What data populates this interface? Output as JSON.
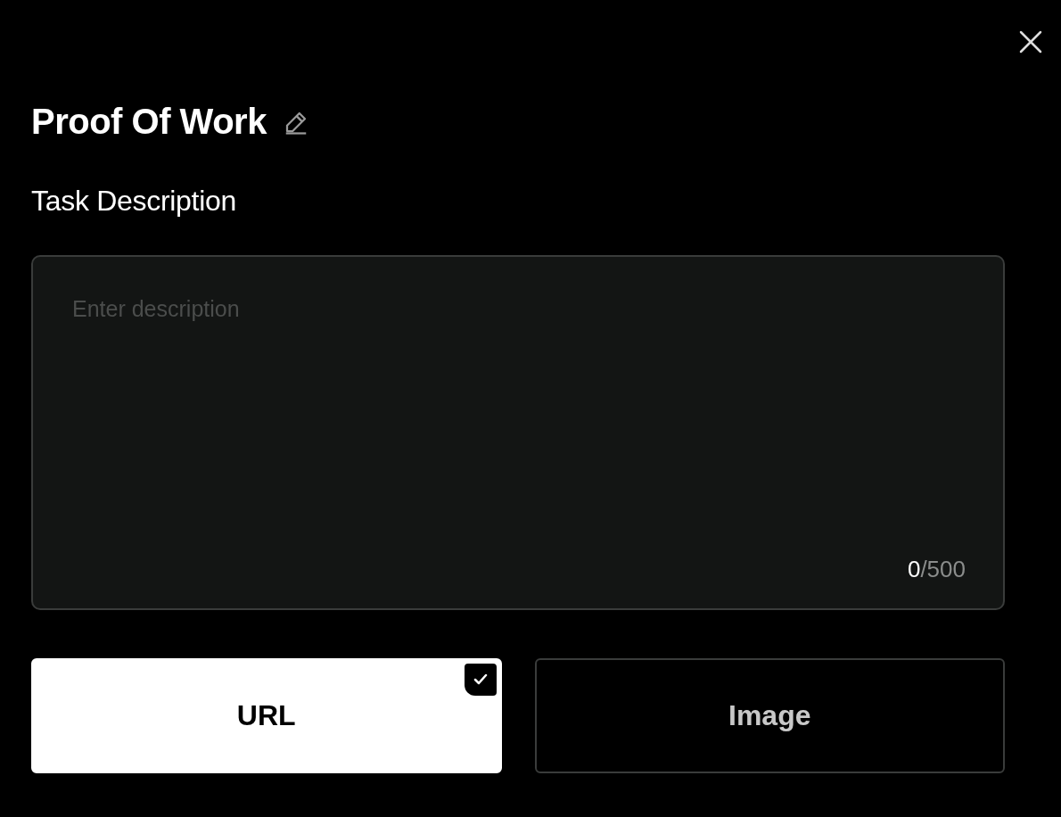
{
  "dialog": {
    "title": "Proof Of Work"
  },
  "description": {
    "label": "Task Description",
    "placeholder": "Enter description",
    "count": "0",
    "limit": "/500"
  },
  "options": [
    {
      "label": "URL",
      "selected": true
    },
    {
      "label": "Image",
      "selected": false
    }
  ]
}
